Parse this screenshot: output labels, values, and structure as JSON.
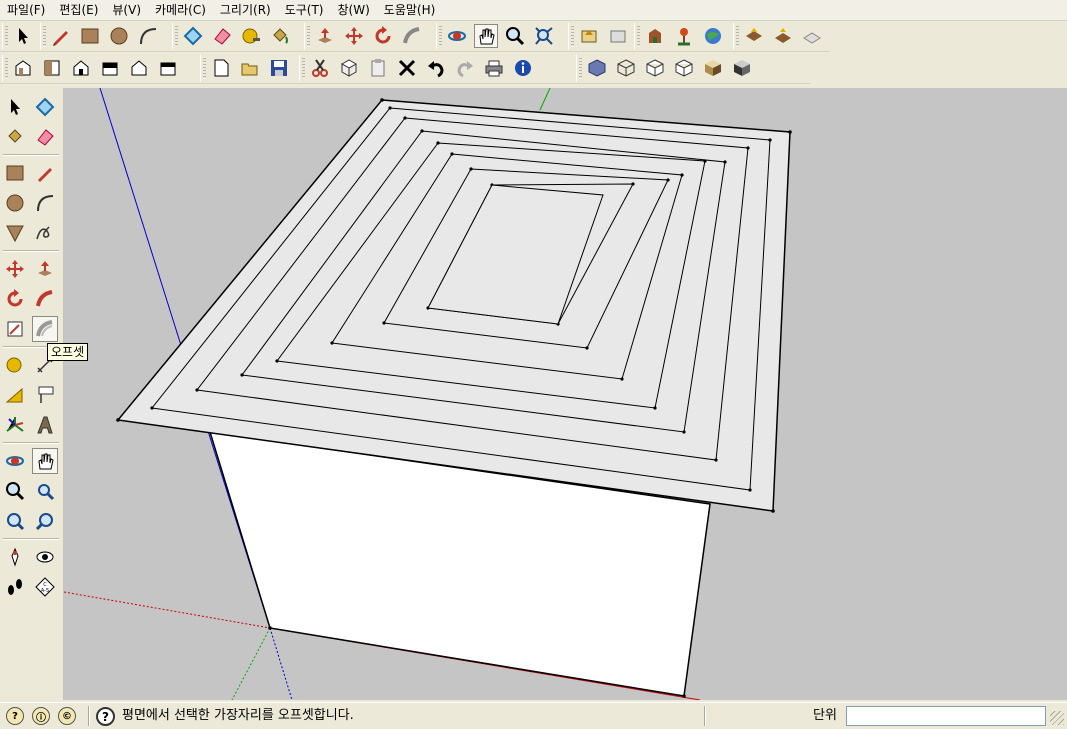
{
  "menu": {
    "items": [
      "파일(F)",
      "편집(E)",
      "뷰(V)",
      "카메라(C)",
      "그리기(R)",
      "도구(T)",
      "창(W)",
      "도움말(H)"
    ]
  },
  "toolbar1": [
    {
      "groups": [
        [
          "select-arrow-icon"
        ],
        [
          "pencil-line-icon",
          "rectangle-icon",
          "circle-icon",
          "arc-icon"
        ],
        [
          "make-component-icon",
          "eraser-icon",
          "tape-measure-icon",
          "paint-bucket-icon"
        ],
        [
          "push-pull-icon",
          "move-icon",
          "rotate-icon",
          "follow-me-icon"
        ],
        [
          "orbit-icon",
          "pan-hand-icon",
          "zoom-icon",
          "zoom-extents-icon"
        ],
        [
          "get-models-icon",
          "share-model-icon"
        ],
        [
          "photo-textures-icon",
          "add-location-icon",
          "google-earth-icon"
        ],
        [
          "sandbox-icon",
          "sandbox-drape-icon",
          "sandbox-stamp-icon"
        ]
      ]
    }
  ],
  "toolbar2": [
    {
      "groups": [
        [
          "iso-view-icon",
          "top-view-icon",
          "front-view-icon",
          "right-view-icon",
          "back-view-icon",
          "left-view-icon"
        ],
        [
          "new-file-icon",
          "open-file-icon",
          "save-file-icon"
        ],
        [
          "cut-icon",
          "copy-icon",
          "paste-icon",
          "delete-icon",
          "undo-icon",
          "redo-icon",
          "print-icon",
          "model-info-icon"
        ],
        [
          "xray-style-icon",
          "wireframe-style-icon",
          "hidden-line-style-icon",
          "shaded-style-icon",
          "shaded-textures-style-icon",
          "monochrome-style-icon"
        ]
      ]
    }
  ],
  "tooltip": {
    "text": "오프셋"
  },
  "statusbar": {
    "icons": [
      "geo-location-icon",
      "credits-icon",
      "account-icon"
    ],
    "help_icon": "?",
    "message": "평면에서 선택한 가장자리를 오프셋합니다.",
    "unit_label": "단위",
    "unit_value": ""
  },
  "colors": {
    "face_top": "#e8e8e8",
    "face_side": "#ffffff",
    "background": "#c5c5c5",
    "axis_blue": "#0000cc",
    "axis_green": "#00aa00",
    "axis_red": "#cc0000"
  }
}
